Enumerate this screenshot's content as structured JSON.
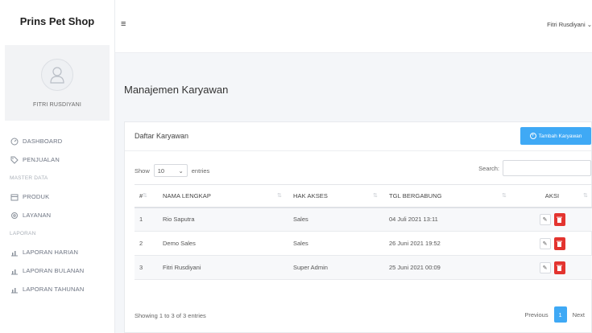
{
  "brand": "Prins Pet Shop",
  "user": {
    "name": "FITRI RUSDIYANI"
  },
  "nav": {
    "dashboard": "DASHBOARD",
    "penjualan": "PENJUALAN",
    "master_heading": "MASTER DATA",
    "produk": "PRODUK",
    "layanan": "LAYANAN",
    "laporan_heading": "LAPORAN",
    "laporan_harian": "LAPORAN HARIAN",
    "laporan_bulanan": "LAPORAN BULANAN",
    "laporan_tahunan": "LAPORAN TAHUNAN"
  },
  "topbar": {
    "menu_icon": "≡",
    "user_menu": "Fitri Rusdiyani ⌄"
  },
  "page_title": "Manajemen Karyawan",
  "card": {
    "title": "Daftar Karyawan",
    "add_button": "Tambah Karyawan",
    "show_label": "Show",
    "entries_value": "10",
    "entries_label": "entries",
    "search_label": "Search:",
    "search_value": "",
    "columns": [
      "#",
      "NAMA LENGKAP",
      "HAK AKSES",
      "TGL BERGABUNG",
      "AKSI"
    ],
    "rows": [
      {
        "no": "1",
        "nama": "Rio Saputra",
        "hak": "Sales",
        "tgl": "04 Juli 2021 13:11"
      },
      {
        "no": "2",
        "nama": "Demo Sales",
        "hak": "Sales",
        "tgl": "26 Juni 2021 19:52"
      },
      {
        "no": "3",
        "nama": "Fitri Rusdiyani",
        "hak": "Super Admin",
        "tgl": "25 Juni 2021 00:09"
      }
    ],
    "info": "Showing 1 to 3 of 3 entries",
    "pager": {
      "previous": "Previous",
      "current": "1",
      "next": "Next"
    }
  },
  "colors": {
    "accent": "#3fa9f5",
    "danger": "#e3342f"
  }
}
